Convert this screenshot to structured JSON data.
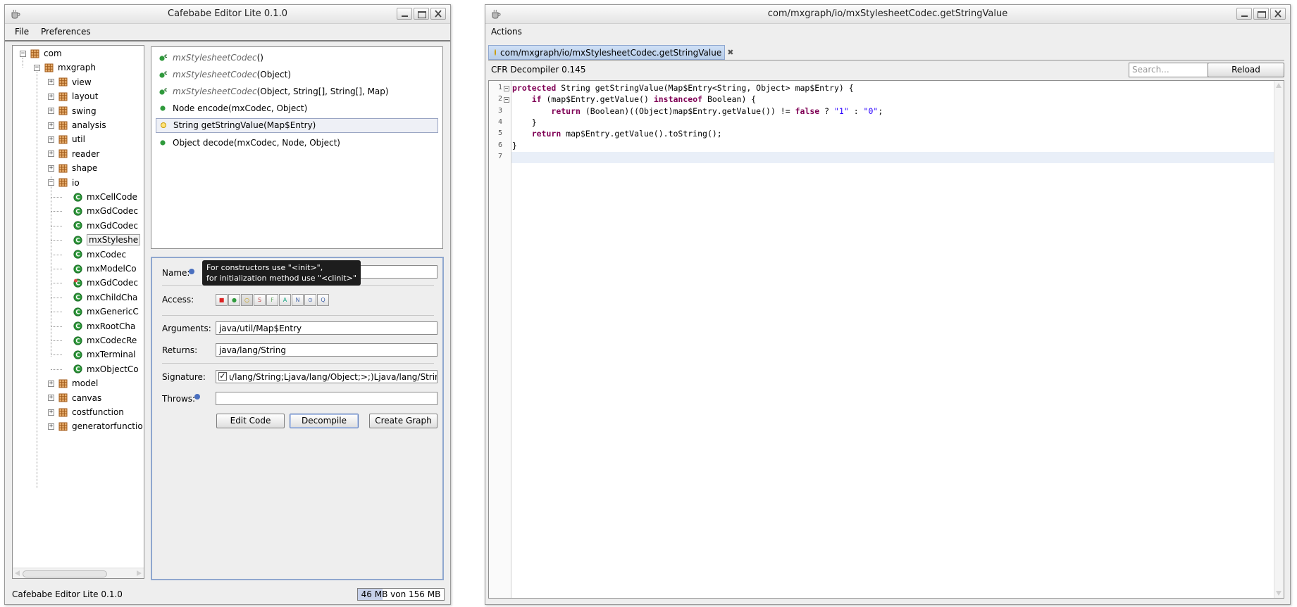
{
  "left_window": {
    "title": "Cafebabe Editor Lite 0.1.0",
    "menu": [
      "File",
      "Preferences"
    ],
    "tree": {
      "root": "com",
      "child": "mxgraph",
      "packages_top": [
        "view",
        "layout",
        "swing",
        "analysis",
        "util",
        "reader",
        "shape",
        "io"
      ],
      "io_classes": [
        "mxCellCode",
        "mxGdCodec",
        "mxGdCodec",
        "mxStyleshe",
        "mxCodec",
        "mxModelCo",
        "mxGdCodec",
        "mxChildCha",
        "mxGenericC",
        "mxRootCha",
        "mxCodecRe",
        "mxTerminal",
        "mxObjectCo"
      ],
      "packages_bottom": [
        "model",
        "canvas",
        "costfunction",
        "generatorfunctio"
      ]
    },
    "methods": [
      {
        "name": "mxStylesheetCodec",
        "args": "()",
        "kind": "constructor"
      },
      {
        "name": "mxStylesheetCodec",
        "args": "(Object)",
        "kind": "constructor"
      },
      {
        "name": "mxStylesheetCodec",
        "args": "(Object, String[], String[], Map)",
        "kind": "constructor"
      },
      {
        "name": "Node encode(mxCodec, Object)",
        "args": "",
        "kind": "public"
      },
      {
        "name": "String getStringValue(Map$Entry)",
        "args": "",
        "kind": "protected"
      },
      {
        "name": "Object decode(mxCodec, Node, Object)",
        "args": "",
        "kind": "public"
      }
    ],
    "form": {
      "name_label": "Name:",
      "access_label": "Access:",
      "access_buttons": [
        "■",
        "●",
        "○",
        "S",
        "F",
        "A",
        "N",
        "⊙",
        "Q"
      ],
      "arguments_label": "Arguments:",
      "arguments_value": "java/util/Map$Entry",
      "returns_label": "Returns:",
      "returns_value": "java/lang/String",
      "signature_label": "Signature:",
      "signature_value": "ι/lang/String;Ljava/lang/Object;>;)Ljava/lang/String;",
      "throws_label": "Throws:",
      "throws_value": "",
      "buttons": {
        "edit": "Edit Code",
        "decompile": "Decompile",
        "graph": "Create Graph"
      }
    },
    "tooltip": {
      "line1": "For constructors use \"<init>\",",
      "line2": "for initialization method use \"<clinit>\""
    },
    "status": {
      "text": "Cafebabe Editor Lite 0.1.0",
      "memory": "46 MB von 156 MB",
      "memory_used_fraction": 0.29
    }
  },
  "right_window": {
    "title": "com/mxgraph/io/mxStylesheetCodec.getStringValue",
    "menu": [
      "Actions"
    ],
    "tab_label": "com/mxgraph/io/mxStylesheetCodec.getStringValue",
    "decompiler_label": "CFR Decompiler 0.145",
    "search_placeholder": "Search...",
    "reload_label": "Reload",
    "code_lines": [
      "protected String getStringValue(Map$Entry<String, Object> map$Entry) {",
      "    if (map$Entry.getValue() instanceof Boolean) {",
      "        return (Boolean)((Object)map$Entry.getValue()) != false ? \"1\" : \"0\";",
      "    }",
      "    return map$Entry.getValue().toString();",
      "}",
      ""
    ],
    "line_numbers": [
      "1",
      "2",
      "3",
      "4",
      "5",
      "6",
      "7"
    ]
  }
}
